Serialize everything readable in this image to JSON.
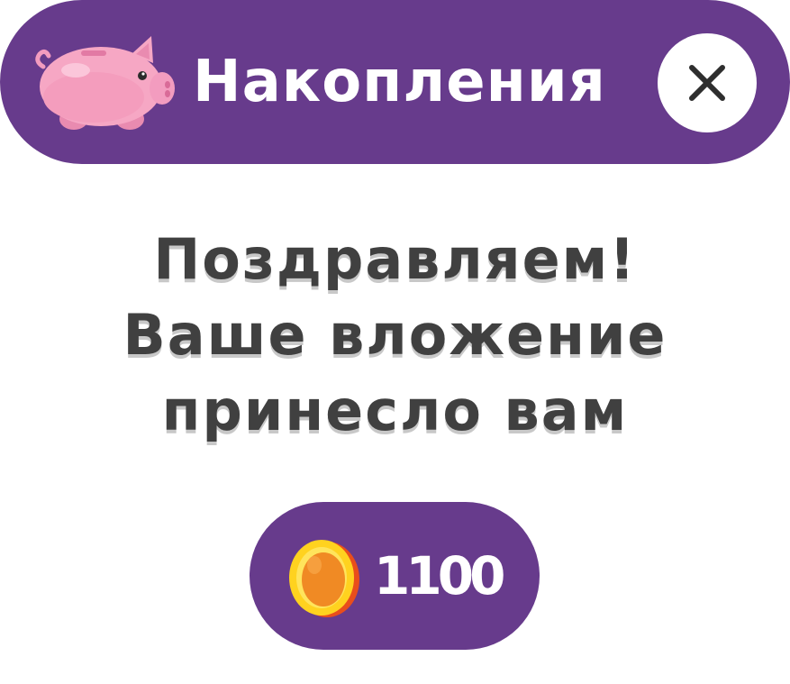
{
  "header": {
    "title": "Накопления",
    "icon": "piggy-bank-icon",
    "close_icon": "close-icon"
  },
  "message": {
    "lines": [
      "Поздравляем!",
      "Ваше вложение",
      "принесло вам"
    ]
  },
  "reward": {
    "icon": "coin-icon",
    "amount": "1100"
  },
  "colors": {
    "brand_purple": "#673b8c",
    "text_dark": "#404040",
    "piggy_pink": "#f6a7c4",
    "coin_orange": "#f08a24",
    "coin_yellow": "#ffd21f"
  }
}
